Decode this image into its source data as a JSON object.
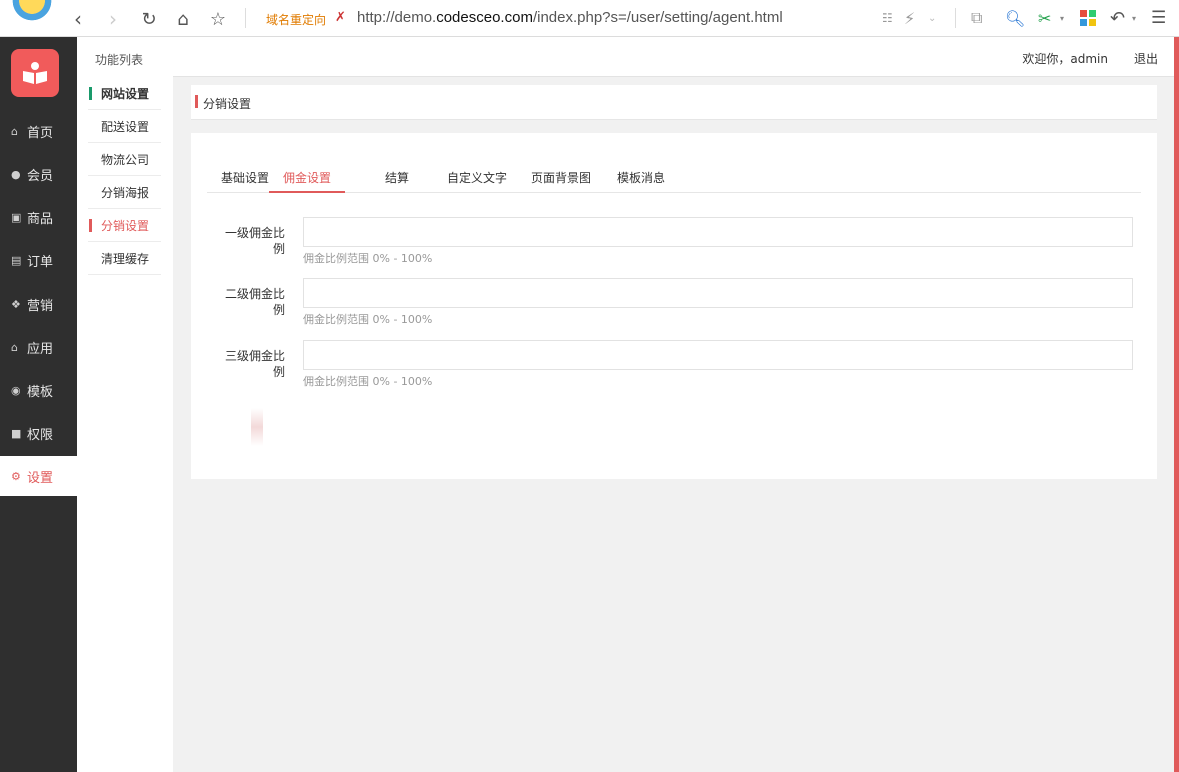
{
  "browser": {
    "redirect_label": "域名重定向",
    "url_prefix": "http://demo.",
    "url_domain": "codesceo.com",
    "url_path": "/index.php?s=/user/setting/agent.html"
  },
  "sidebar": {
    "items": [
      {
        "label": "首页",
        "icon": "home-icon"
      },
      {
        "label": "会员",
        "icon": "user-icon"
      },
      {
        "label": "商品",
        "icon": "gift-icon"
      },
      {
        "label": "订单",
        "icon": "clipboard-icon"
      },
      {
        "label": "营销",
        "icon": "dropbox-icon"
      },
      {
        "label": "应用",
        "icon": "bank-icon"
      },
      {
        "label": "模板",
        "icon": "camera-icon"
      },
      {
        "label": "权限",
        "icon": "id-card-icon"
      },
      {
        "label": "设置",
        "icon": "gear-icon",
        "active": true
      }
    ]
  },
  "submenu": {
    "title": "功能列表",
    "items": [
      {
        "label": "网站设置"
      },
      {
        "label": "配送设置"
      },
      {
        "label": "物流公司"
      },
      {
        "label": "分销海报"
      },
      {
        "label": "分销设置",
        "active": true
      },
      {
        "label": "清理缓存"
      }
    ]
  },
  "header": {
    "welcome": "欢迎你，admin",
    "logout": "退出"
  },
  "breadcrumb": "分销设置",
  "tabs": [
    {
      "label": "基础设置"
    },
    {
      "label": "佣金设置",
      "active": true
    },
    {
      "label": "结算"
    },
    {
      "label": "自定义文字"
    },
    {
      "label": "页面背景图"
    },
    {
      "label": "模板消息"
    }
  ],
  "form": {
    "fields": [
      {
        "label_line1": "一级佣金比",
        "label_line2": "例",
        "value": "",
        "hint": "佣金比例范围 0% - 100%"
      },
      {
        "label_line1": "二级佣金比",
        "label_line2": "例",
        "value": "",
        "hint": "佣金比例范围 0% - 100%"
      },
      {
        "label_line1": "三级佣金比",
        "label_line2": "例",
        "value": "",
        "hint": "佣金比例范围 0% - 100%"
      }
    ]
  },
  "colors": {
    "accent": "#e05a5a",
    "sidebar_bg": "#2f2f2f",
    "green_marker": "#1a9a6b"
  }
}
